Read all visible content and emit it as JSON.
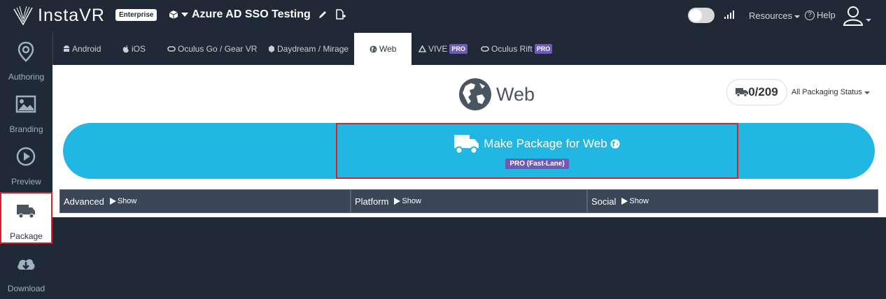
{
  "app": {
    "logo_text": "InstaVR",
    "edition_badge": "Enterprise",
    "project_title": "Azure AD SSO Testing"
  },
  "header": {
    "resources_label": "Resources",
    "help_label": "Help"
  },
  "sidebar": {
    "items": [
      {
        "label": "Authoring",
        "icon": "map-pin-icon"
      },
      {
        "label": "Branding",
        "icon": "image-icon"
      },
      {
        "label": "Preview",
        "icon": "play-circle-icon"
      },
      {
        "label": "Package",
        "icon": "truck-icon",
        "active": true
      },
      {
        "label": "Download",
        "icon": "cloud-download-icon"
      }
    ]
  },
  "platform_tabs": [
    {
      "label": "Android",
      "icon": "android-icon"
    },
    {
      "label": "iOS",
      "icon": "apple-icon"
    },
    {
      "label": "Oculus Go / Gear VR",
      "icon": "oculus-icon"
    },
    {
      "label": "Daydream / Mirage",
      "icon": "daydream-icon"
    },
    {
      "label": "Web",
      "icon": "globe-icon",
      "active": true
    },
    {
      "label": "VIVE",
      "icon": "vive-icon",
      "badge": "PRO"
    },
    {
      "label": "Oculus Rift",
      "icon": "oculus-icon",
      "badge": "PRO"
    }
  ],
  "panel": {
    "title": "Web",
    "package_count": "0/209",
    "status_filter": "All Packaging Status",
    "make_button_label": "Make Package for Web",
    "make_button_badge": "PRO (Fast-Lane)"
  },
  "sections": [
    {
      "label": "Advanced",
      "toggle": "Show"
    },
    {
      "label": "Platform",
      "toggle": "Show"
    },
    {
      "label": "Social",
      "toggle": "Show"
    }
  ],
  "colors": {
    "background": "#1f2a36",
    "accent_blue": "#22b6e3",
    "pro_purple": "#6f5bb7",
    "highlight_red": "#d4232c"
  }
}
